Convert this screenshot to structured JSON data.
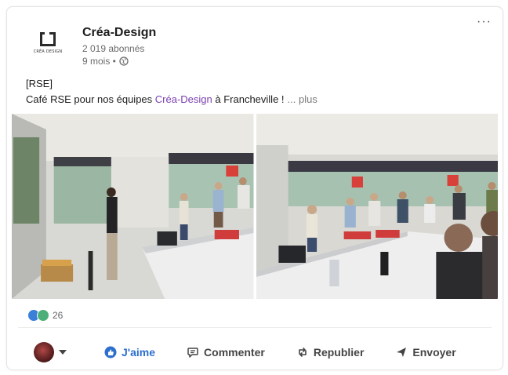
{
  "post": {
    "author": "Créa-Design",
    "logo_text": "CRÉA DESIGN",
    "followers": "2 019 abonnés",
    "time": "9 mois •",
    "tag": "[RSE]",
    "text_before": "Café RSE pour nos équipes ",
    "mention": "Créa-Design",
    "text_after": " à Francheville !",
    "see_more": "... plus",
    "more_menu": "···"
  },
  "reactions": {
    "count": "26"
  },
  "actions": {
    "like": "J'aime",
    "comment": "Commenter",
    "repost": "Republier",
    "send": "Envoyer"
  },
  "icons": {
    "globe": "globe-icon",
    "like": "thumbs-up-icon",
    "comment": "comment-icon",
    "repost": "repost-icon",
    "send": "send-icon"
  },
  "colors": {
    "mention": "#7b3fb0",
    "like_active": "#2d6fcf"
  }
}
